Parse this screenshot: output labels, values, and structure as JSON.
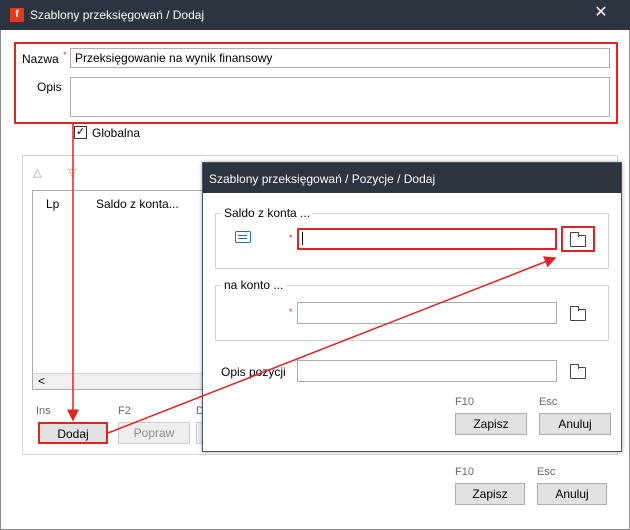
{
  "window": {
    "title": "Szablony przeksięgowań / Dodaj",
    "app_icon": "app-icon",
    "close_glyph": "✕"
  },
  "form": {
    "nazwa_label": "Nazwa",
    "nazwa_value": "Przeksięgowanie na wynik finansowy",
    "opis_label": "Opis",
    "opis_value": "",
    "globalna_label": "Globalna",
    "globalna_checked": true,
    "required_mark": "*"
  },
  "list": {
    "columns": [
      "Lp",
      "Saldo z konta..."
    ],
    "scroll_left": "<"
  },
  "buttons": {
    "dodaj_key": "Ins",
    "dodaj_label": "Dodaj",
    "popraw_key": "F2",
    "popraw_label": "Popraw",
    "third_key": "D",
    "zapisz_key": "F10",
    "zapisz_label": "Zapisz",
    "anuluj_key": "Esc",
    "anuluj_label": "Anuluj"
  },
  "dialog": {
    "title": "Szablony przeksięgowań / Pozycje / Dodaj",
    "saldo_group": "Saldo z konta ...",
    "saldo_value": "",
    "na_konto_group": "na konto ...",
    "na_konto_value": "",
    "opis_label": "Opis pozycji",
    "opis_value": "",
    "zapisz_key": "F10",
    "zapisz_label": "Zapisz",
    "anuluj_key": "Esc",
    "anuluj_label": "Anuluj",
    "required_mark": "*"
  },
  "colors": {
    "titlebar": "#2b3440",
    "highlight": "#e32222",
    "accent_icon": "#1f6fb5"
  }
}
